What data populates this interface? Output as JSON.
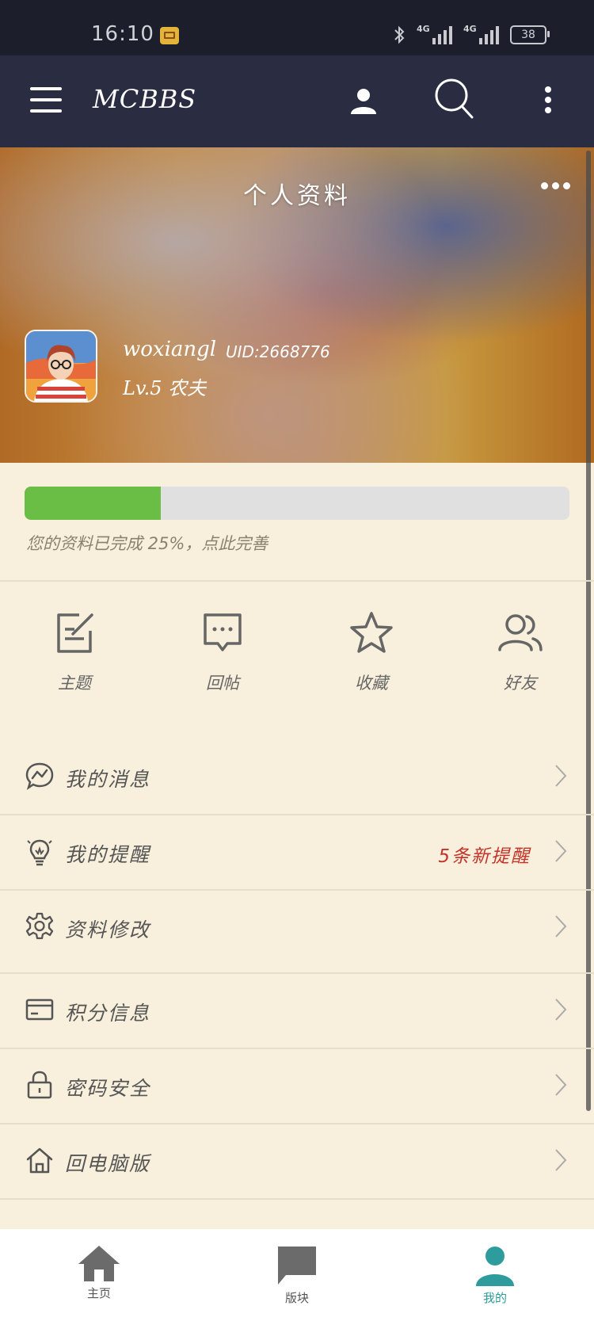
{
  "status": {
    "time": "16:10",
    "signal1": "4G",
    "signal2": "4G",
    "battery": "38"
  },
  "appbar": {
    "title": "MCBBS"
  },
  "profile": {
    "header_title": "个人资料",
    "username": "woxiangl",
    "uid": "UID:2668776",
    "level": "Lv.5 农夫",
    "completion": 0.25,
    "completion_text": "您的资料已完成 25%，点此完善"
  },
  "quick_actions": [
    {
      "label": "主题",
      "icon": "edit-icon"
    },
    {
      "label": "回帖",
      "icon": "comment-icon"
    },
    {
      "label": "收藏",
      "icon": "star-icon"
    },
    {
      "label": "好友",
      "icon": "friends-icon"
    }
  ],
  "menu": [
    {
      "label": "我的消息",
      "icon": "message-icon",
      "note": ""
    },
    {
      "label": "我的提醒",
      "icon": "bulb-icon",
      "note": "5条新提醒"
    },
    {
      "label": "资料修改",
      "icon": "gear-icon",
      "note": ""
    },
    {
      "label": "积分信息",
      "icon": "card-icon",
      "note": ""
    },
    {
      "label": "密码安全",
      "icon": "lock-icon",
      "note": ""
    },
    {
      "label": "回电脑版",
      "icon": "home-outline-icon",
      "note": ""
    }
  ],
  "bottom_nav": [
    {
      "label": "主页",
      "icon": "home-icon"
    },
    {
      "label": "版块",
      "icon": "forum-icon"
    },
    {
      "label": "我的",
      "icon": "person-icon",
      "active": true
    }
  ],
  "colors": {
    "accent": "#2e9c9c",
    "progress": "#6abd45",
    "alert": "#c4322a",
    "appbar": "#2a2d42"
  }
}
